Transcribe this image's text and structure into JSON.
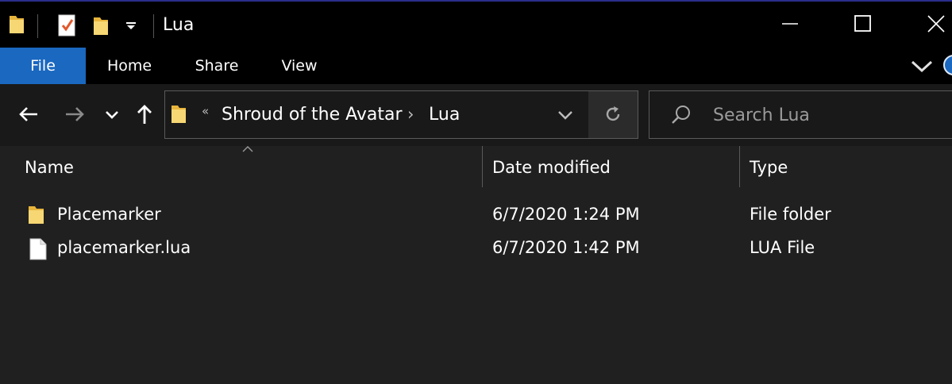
{
  "window": {
    "title": "Lua",
    "minimize_icon": "minimize-icon",
    "maximize_icon": "maximize-icon",
    "close_icon": "close-icon"
  },
  "quick_access": {
    "icons": [
      "folder-icon",
      "properties-icon",
      "new-folder-icon",
      "customize-dropdown-icon"
    ]
  },
  "ribbon": {
    "tabs": [
      {
        "label": "File",
        "active": true
      },
      {
        "label": "Home"
      },
      {
        "label": "Share"
      },
      {
        "label": "View"
      }
    ],
    "expand_icon": "chevron-down-icon",
    "accent_color": "#1a68c0"
  },
  "navigation": {
    "back_icon": "back-arrow-icon",
    "forward_icon": "forward-arrow-icon",
    "recent_icon": "recent-locations-icon",
    "up_icon": "up-arrow-icon"
  },
  "address": {
    "overflow": "«",
    "breadcrumb": [
      "Shroud of the Avatar",
      "Lua"
    ],
    "separator": "›",
    "dropdown_icon": "chevron-down-icon",
    "refresh_icon": "refresh-icon"
  },
  "search": {
    "placeholder": "Search Lua",
    "icon": "search-icon"
  },
  "columns": {
    "name": "Name",
    "date_modified": "Date modified",
    "type": "Type"
  },
  "files": [
    {
      "name": "Placemarker",
      "date_modified": "6/7/2020 1:24 PM",
      "type": "File folder",
      "icon": "folder-icon"
    },
    {
      "name": "placemarker.lua",
      "date_modified": "6/7/2020 1:42 PM",
      "type": "LUA File",
      "icon": "file-icon"
    }
  ]
}
